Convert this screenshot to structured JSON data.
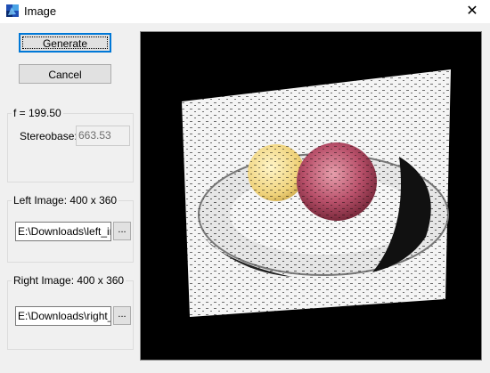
{
  "window": {
    "title": "Image",
    "close_glyph": "✕"
  },
  "buttons": {
    "generate": "Generate",
    "cancel": "Cancel"
  },
  "focal": {
    "legend": "f = 199.50",
    "stereobase_label": "Stereobase:",
    "stereobase_value": "663.53"
  },
  "left_image": {
    "legend_label": "Left Image:",
    "size": "400 x  360",
    "path": "E:\\Downloads\\left_ir",
    "browse": "..."
  },
  "right_image": {
    "legend_label": "Right Image:",
    "size": "400 x  360",
    "path": "E:\\Downloads\\right_",
    "browse": "..."
  },
  "icons": {
    "app": "app-icon",
    "close": "close-icon"
  }
}
